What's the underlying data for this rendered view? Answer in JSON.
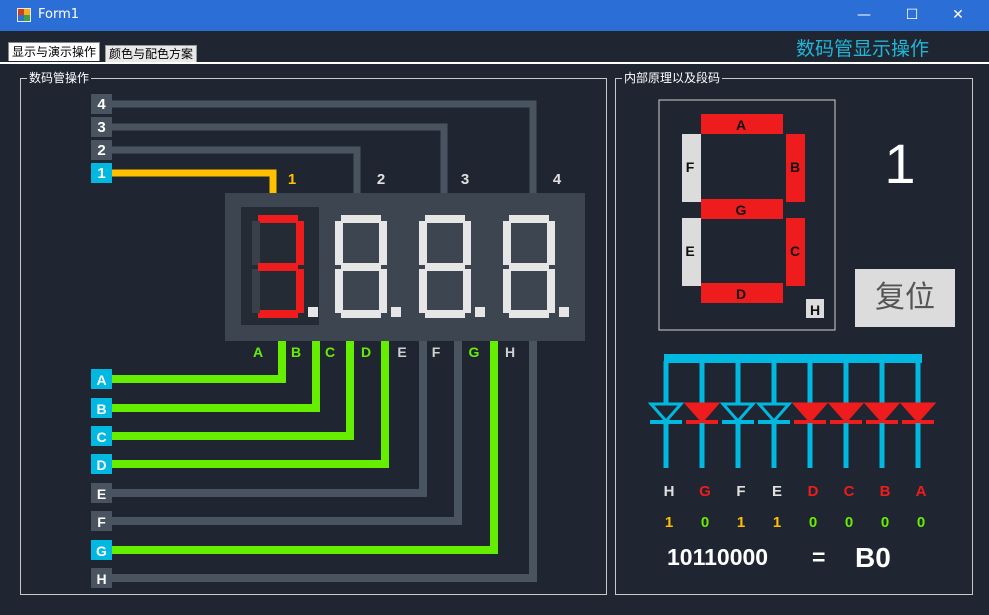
{
  "window": {
    "title": "Form1",
    "minimize": "—",
    "maximize": "☐",
    "close": "✕"
  },
  "tabs": [
    {
      "label": "显示与演示操作"
    },
    {
      "label": "颜色与配色方案"
    }
  ],
  "heading": "数码管显示操作",
  "left_group": {
    "title": "数码管操作"
  },
  "right_group": {
    "title": "内部原理以及段码"
  },
  "digit_select_buttons": [
    {
      "label": "4"
    },
    {
      "label": "3"
    },
    {
      "label": "2"
    },
    {
      "label": "1",
      "active": true
    }
  ],
  "digit_labels": [
    "1",
    "2",
    "3",
    "4"
  ],
  "segment_buttons": [
    {
      "label": "A",
      "active": true
    },
    {
      "label": "B",
      "active": true
    },
    {
      "label": "C",
      "active": true
    },
    {
      "label": "D",
      "active": true
    },
    {
      "label": "E",
      "active": false
    },
    {
      "label": "F",
      "active": false
    },
    {
      "label": "G",
      "active": true
    },
    {
      "label": "H",
      "active": false
    }
  ],
  "pin_labels": [
    "A",
    "B",
    "C",
    "D",
    "E",
    "F",
    "G",
    "H"
  ],
  "diagram": {
    "segments": [
      "A",
      "B",
      "C",
      "D",
      "E",
      "F",
      "G",
      "H"
    ],
    "lit": [
      "A",
      "B",
      "C",
      "D",
      "G"
    ]
  },
  "current_digit": "1",
  "reset_label": "复位",
  "bits": [
    {
      "seg": "H",
      "bit": "1",
      "on": false
    },
    {
      "seg": "G",
      "bit": "0",
      "on": true
    },
    {
      "seg": "F",
      "bit": "1",
      "on": false
    },
    {
      "seg": "E",
      "bit": "1",
      "on": false
    },
    {
      "seg": "D",
      "bit": "0",
      "on": true
    },
    {
      "seg": "C",
      "bit": "0",
      "on": true
    },
    {
      "seg": "B",
      "bit": "0",
      "on": true
    },
    {
      "seg": "A",
      "bit": "0",
      "on": true
    }
  ],
  "binary": "10110000",
  "equals": "=",
  "hex": "B0",
  "colors": {
    "active_green": "#66ee00",
    "active_yellow": "#ffc000",
    "cyan": "#00b8e0",
    "red": "#ee1c1c",
    "inactive": "#4a5461",
    "bg": "#1f2631"
  }
}
